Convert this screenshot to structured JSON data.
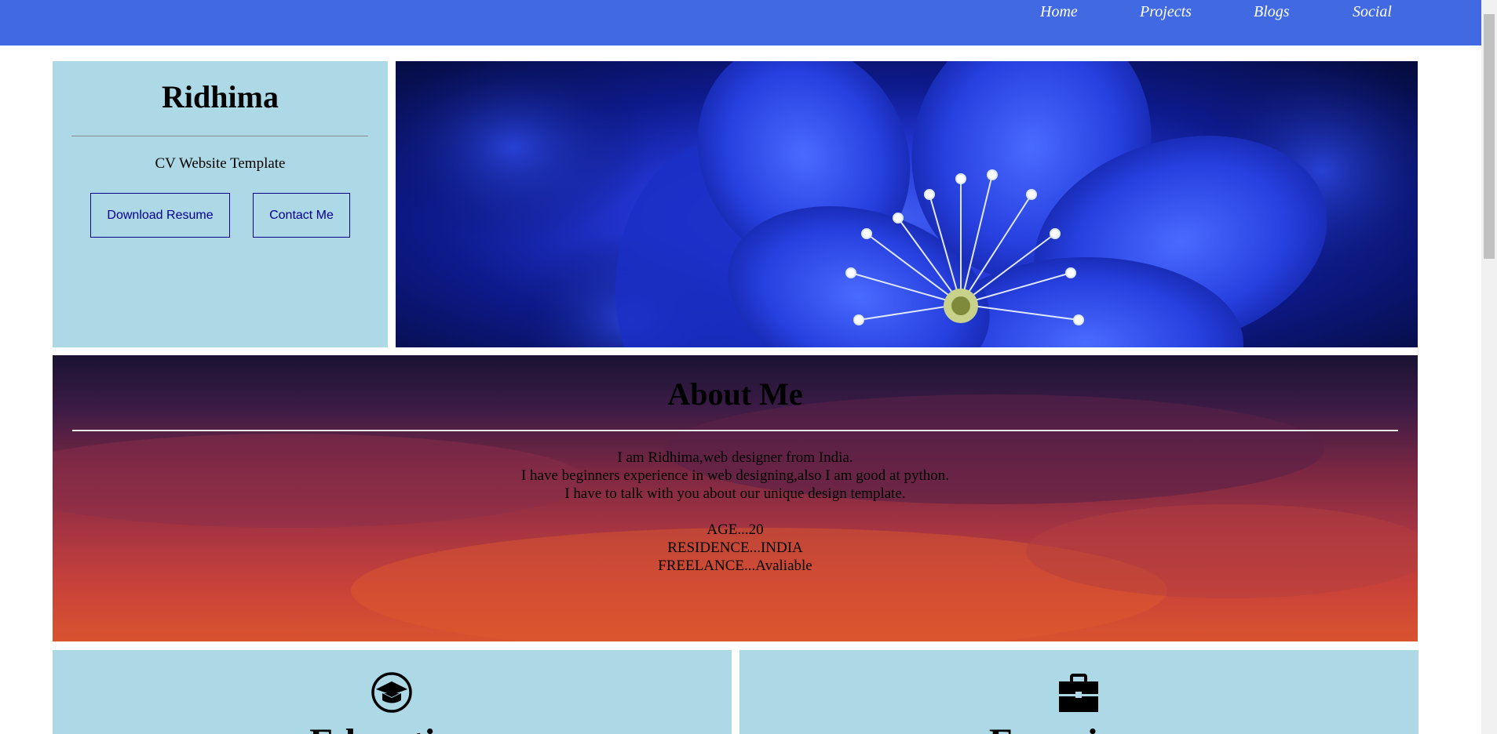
{
  "nav": {
    "home": "Home",
    "projects": "Projects",
    "blogs": "Blogs",
    "social": "Social"
  },
  "profile": {
    "name": "Ridhima",
    "subtitle": "CV Website Template",
    "download_label": "Download Resume",
    "contact_label": "Contact Me"
  },
  "about": {
    "title": "About Me",
    "lines": [
      "I am Ridhima,web designer from India.",
      "I have beginners experience in web designing,also I am good at python.",
      "I have to talk with you about our unique design template."
    ],
    "facts": [
      "AGE...20",
      "RESIDENCE...INDIA",
      "FREELANCE...Avaliable"
    ]
  },
  "cards": {
    "education": {
      "title": "Education",
      "icon": "graduation-cap-icon"
    },
    "experience": {
      "title": "Experience",
      "icon": "briefcase-icon"
    }
  },
  "colors": {
    "navbar": "#4169e1",
    "card_bg": "#add8e6",
    "button_border": "#00008b"
  }
}
